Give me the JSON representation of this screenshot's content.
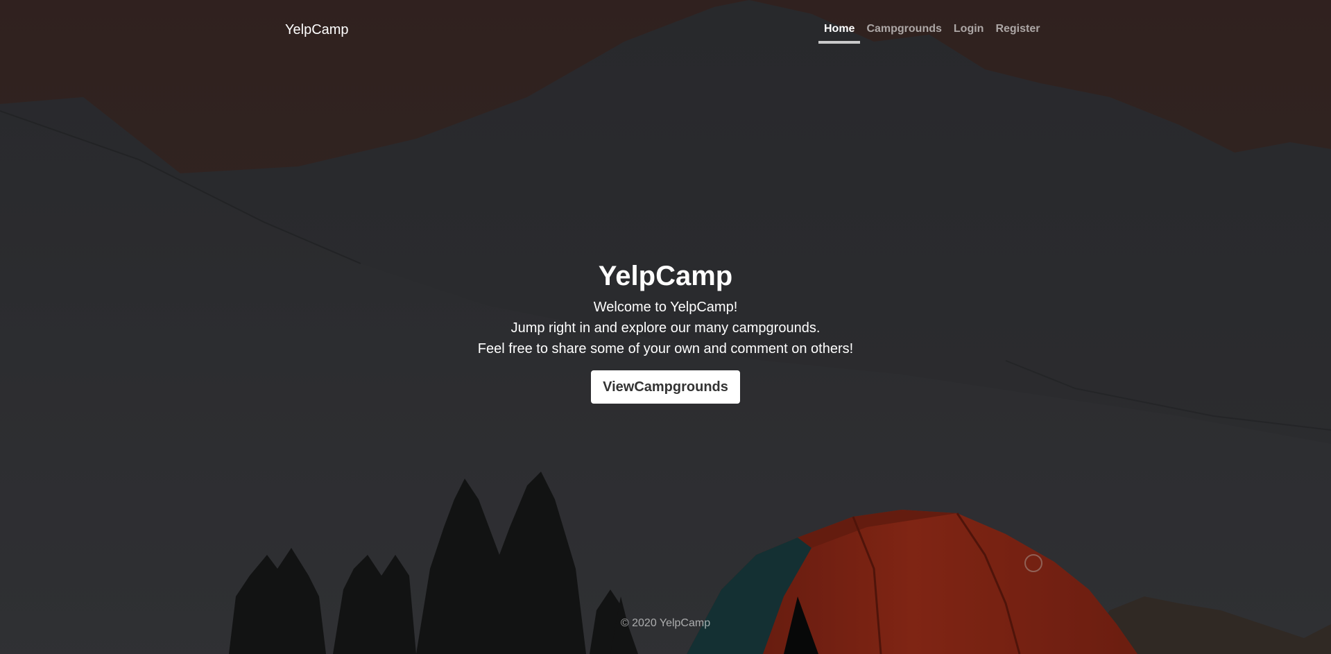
{
  "navbar": {
    "brand": "YelpCamp",
    "links": [
      {
        "label": "Home",
        "active": true
      },
      {
        "label": "Campgrounds",
        "active": false
      },
      {
        "label": "Login",
        "active": false
      },
      {
        "label": "Register",
        "active": false
      }
    ]
  },
  "hero": {
    "title": "YelpCamp",
    "lines": [
      "Welcome to YelpCamp!",
      "Jump right in and explore our many campgrounds.",
      "Feel free to share some of your own and comment on others!"
    ],
    "button_label": "ViewCampgrounds"
  },
  "footer": {
    "text": "© 2020 YelpCamp"
  },
  "background": {
    "description_icon": "mountain-tent-photo",
    "colors": {
      "sky": "#4a3430",
      "mountain": "#3a3b40",
      "tent_red": "#b8321f",
      "tent_teal": "#1f4a4f",
      "trees": "#1a1c1c"
    }
  }
}
